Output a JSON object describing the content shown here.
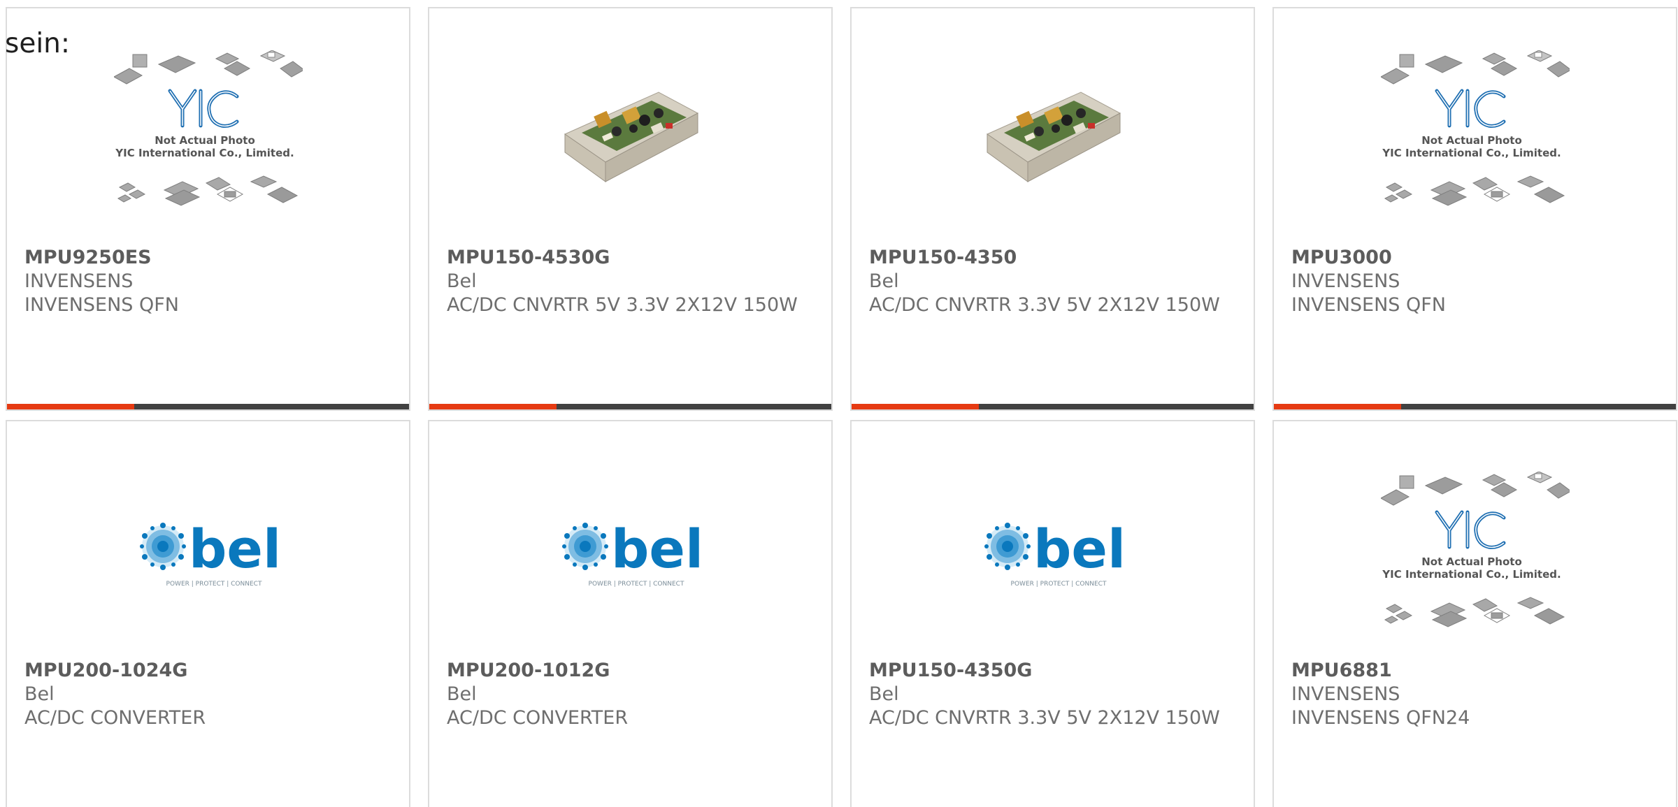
{
  "intro_text": "sein:",
  "colors": {
    "accent": "#e63a12",
    "bar_dark": "#414141",
    "bel_blue": "#0a78bd"
  },
  "placeholder": {
    "line1": "Not Actual Photo",
    "line2": "YIC International Co., Limited.",
    "logo": "YIC"
  },
  "bel_logo": {
    "word": "bel",
    "tagline": "POWER | PROTECT | CONNECT"
  },
  "products": [
    {
      "part": "MPU9250ES",
      "maker": "INVENSENS",
      "desc": "INVENSENS QFN",
      "image": "placeholder-chips"
    },
    {
      "part": "MPU150-4530G",
      "maker": "Bel",
      "desc": "AC/DC CNVRTR 5V 3.3V 2X12V 150W",
      "image": "power-supply-photo"
    },
    {
      "part": "MPU150-4350",
      "maker": "Bel",
      "desc": "AC/DC CNVRTR 3.3V 5V 2X12V 150W",
      "image": "power-supply-photo"
    },
    {
      "part": "MPU3000",
      "maker": "INVENSENS",
      "desc": "INVENSENS QFN",
      "image": "placeholder-chips"
    },
    {
      "part": "MPU200-1024G",
      "maker": "Bel",
      "desc": "AC/DC CONVERTER",
      "image": "bel-logo"
    },
    {
      "part": "MPU200-1012G",
      "maker": "Bel",
      "desc": "AC/DC CONVERTER",
      "image": "bel-logo"
    },
    {
      "part": "MPU150-4350G",
      "maker": "Bel",
      "desc": "AC/DC CNVRTR 3.3V 5V 2X12V 150W",
      "image": "bel-logo"
    },
    {
      "part": "MPU6881",
      "maker": "INVENSENS",
      "desc": "INVENSENS QFN24",
      "image": "placeholder-chips"
    }
  ]
}
